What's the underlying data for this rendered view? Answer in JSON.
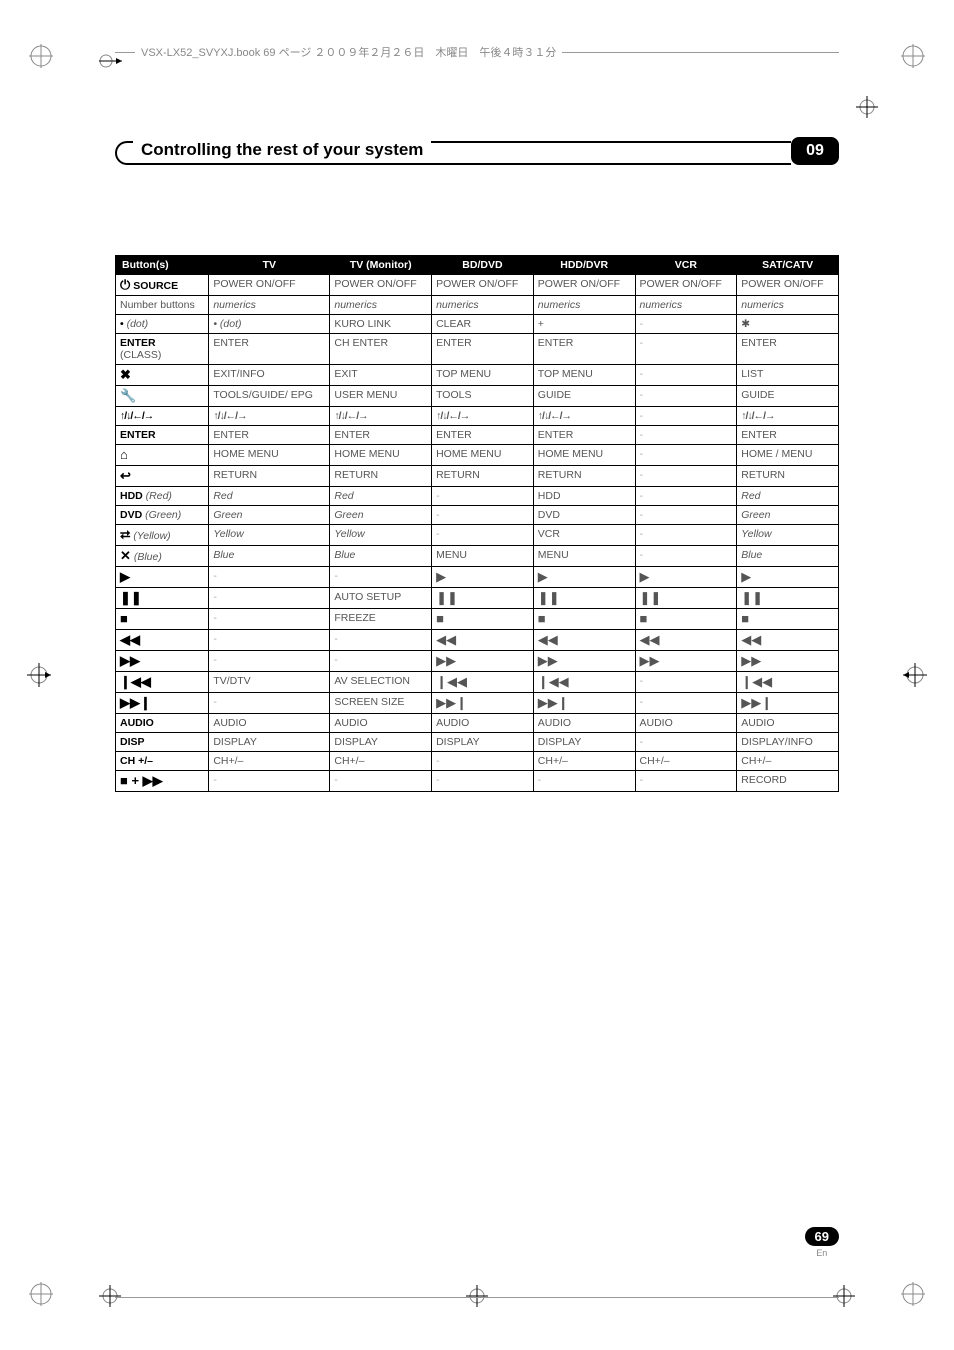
{
  "header_text": "VSX-LX52_SVYXJ.book  69 ページ  ２００９年２月２６日　木曜日　午後４時３１分",
  "chapter": {
    "title": "Controlling the rest of your system",
    "number": "09"
  },
  "page": {
    "number": "69",
    "lang": "En"
  },
  "columns": [
    "Button(s)",
    "TV",
    "TV (Monitor)",
    "BD/DVD",
    "HDD/DVR",
    "VCR",
    "SAT/CATV"
  ],
  "rows": [
    {
      "label_icon": "power",
      "label": "SOURCE",
      "c": [
        "POWER ON/OFF",
        "POWER ON/OFF",
        "POWER ON/OFF",
        "POWER ON/OFF",
        "POWER ON/OFF",
        "POWER ON/OFF"
      ]
    },
    {
      "label": "Number buttons",
      "label_style": "normal",
      "c": [
        "numerics",
        "numerics",
        "numerics",
        "numerics",
        "numerics",
        "numerics"
      ],
      "italic_all": true
    },
    {
      "label": "• (dot)",
      "label_italic_part": "(dot)",
      "c": [
        "• (dot)",
        "KURO LINK",
        "CLEAR",
        "+",
        "-",
        "✱"
      ],
      "cell_italic": [
        0
      ]
    },
    {
      "label": "ENTER",
      "sub": "(CLASS)",
      "c": [
        "ENTER",
        "CH ENTER",
        "ENTER",
        "ENTER",
        "-",
        "ENTER"
      ]
    },
    {
      "label_icon": "x",
      "label": "",
      "c": [
        "EXIT/INFO",
        "EXIT",
        "TOP MENU",
        "TOP MENU",
        "-",
        "LIST"
      ]
    },
    {
      "label_icon": "wrench",
      "label": "",
      "c": [
        "TOOLS/GUIDE/ EPG",
        "USER MENU",
        "TOOLS",
        "GUIDE",
        "-",
        "GUIDE"
      ]
    },
    {
      "label_icon": "arrows",
      "label": "",
      "c": [
        "arrows",
        "arrows",
        "arrows",
        "arrows",
        "-",
        "arrows"
      ]
    },
    {
      "label": "ENTER",
      "c": [
        "ENTER",
        "ENTER",
        "ENTER",
        "ENTER",
        "-",
        "ENTER"
      ]
    },
    {
      "label_icon": "home",
      "label": "",
      "c": [
        "HOME MENU",
        "HOME MENU",
        "HOME MENU",
        "HOME MENU",
        "-",
        "HOME / MENU"
      ]
    },
    {
      "label_icon": "return",
      "label": "",
      "c": [
        "RETURN",
        "RETURN",
        "RETURN",
        "RETURN",
        "-",
        "RETURN"
      ]
    },
    {
      "label": "HDD",
      "label_suffix": " (Red)",
      "c": [
        "Red",
        "Red",
        "-",
        "HDD",
        "-",
        "Red"
      ],
      "cell_italic": [
        0,
        1,
        5
      ]
    },
    {
      "label": "DVD",
      "label_suffix": " (Green)",
      "c": [
        "Green",
        "Green",
        "-",
        "DVD",
        "-",
        "Green"
      ],
      "cell_italic": [
        0,
        1,
        5
      ]
    },
    {
      "label_icon": "loop",
      "label_suffix": " (Yellow)",
      "c": [
        "Yellow",
        "Yellow",
        "-",
        "VCR",
        "-",
        "Yellow"
      ],
      "cell_italic": [
        0,
        1,
        5
      ]
    },
    {
      "label_icon": "shuffle",
      "label_suffix": " (Blue)",
      "c": [
        "Blue",
        "Blue",
        "MENU",
        "MENU",
        "-",
        "Blue"
      ],
      "cell_italic": [
        0,
        1,
        5
      ]
    },
    {
      "label_icon": "play",
      "label": "",
      "c": [
        "-",
        "-",
        "play",
        "play",
        "play",
        "play"
      ]
    },
    {
      "label_icon": "pause",
      "label": "",
      "c": [
        "-",
        "AUTO SETUP",
        "pause",
        "pause",
        "pause",
        "pause"
      ]
    },
    {
      "label_icon": "stop",
      "label": "",
      "c": [
        "-",
        "FREEZE",
        "stop",
        "stop",
        "stop",
        "stop"
      ]
    },
    {
      "label_icon": "rew",
      "label": "",
      "c": [
        "-",
        "-",
        "rew",
        "rew",
        "rew",
        "rew"
      ]
    },
    {
      "label_icon": "ff",
      "label": "",
      "c": [
        "-",
        "-",
        "ff",
        "ff",
        "ff",
        "ff"
      ]
    },
    {
      "label_icon": "prev",
      "label": "",
      "c": [
        "TV/DTV",
        "AV SELECTION",
        "prev",
        "prev",
        "-",
        "prev"
      ]
    },
    {
      "label_icon": "next",
      "label": "",
      "c": [
        "-",
        "SCREEN SIZE",
        "next",
        "next",
        "-",
        "next"
      ]
    },
    {
      "label": "AUDIO",
      "c": [
        "AUDIO",
        "AUDIO",
        "AUDIO",
        "AUDIO",
        "AUDIO",
        "AUDIO"
      ]
    },
    {
      "label": "DISP",
      "c": [
        "DISPLAY",
        "DISPLAY",
        "DISPLAY",
        "DISPLAY",
        "-",
        "DISPLAY/INFO"
      ]
    },
    {
      "label": "CH +/–",
      "c": [
        "CH+/–",
        "CH+/–",
        "-",
        "CH+/–",
        "CH+/–",
        "CH+/–"
      ]
    },
    {
      "label_icon": "stop_ff",
      "label": "",
      "c": [
        "-",
        "-",
        "-",
        "-",
        "-",
        "RECORD"
      ]
    }
  ],
  "icons": {
    "power": "⏻",
    "x": "✖",
    "wrench": "🔧",
    "home": "⌂",
    "return": "↩",
    "loop": "⮂",
    "shuffle": "✕",
    "play": "▶",
    "pause": "❚❚",
    "stop": "■",
    "rew": "◀◀",
    "ff": "▶▶",
    "prev": "❙◀◀",
    "next": "▶▶❙",
    "stop_ff": "■ + ▶▶",
    "arrows": "↑/↓/←/→"
  }
}
